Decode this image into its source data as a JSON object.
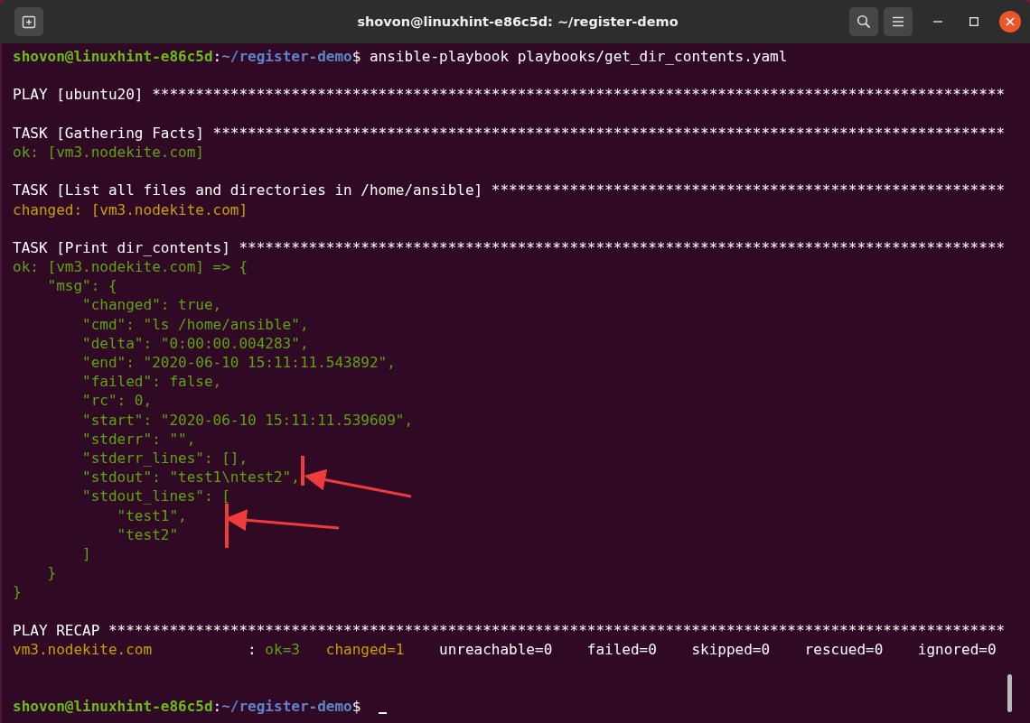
{
  "window": {
    "title": "shovon@linuxhint-e86c5d: ~/register-demo"
  },
  "lines": [
    {
      "spans": [
        {
          "kind": "user",
          "text": "shovon@linuxhint-e86c5d"
        },
        {
          "kind": "plain",
          "text": ":"
        },
        {
          "kind": "path",
          "text": "~/register-demo"
        },
        {
          "kind": "plain",
          "text": "$ ansible-playbook playbooks/get_dir_contents.yaml"
        }
      ]
    },
    {
      "blank_before": true,
      "spans": [
        {
          "kind": "plain",
          "text": "PLAY [ubuntu20] **************************************************************************************************"
        }
      ]
    },
    {
      "blank_before": true,
      "spans": [
        {
          "kind": "plain",
          "text": "TASK [Gathering Facts] *******************************************************************************************"
        }
      ]
    },
    {
      "spans": [
        {
          "kind": "ok",
          "text": "ok: [vm3.nodekite.com]"
        }
      ]
    },
    {
      "blank_before": true,
      "spans": [
        {
          "kind": "plain",
          "text": "TASK [List all files and directories in /home/ansible] ***********************************************************"
        }
      ]
    },
    {
      "spans": [
        {
          "kind": "changed",
          "text": "changed: [vm3.nodekite.com]"
        }
      ]
    },
    {
      "blank_before": true,
      "spans": [
        {
          "kind": "plain",
          "text": "TASK [Print dir_contents] ****************************************************************************************"
        }
      ]
    },
    {
      "spans": [
        {
          "kind": "ok",
          "text": "ok: [vm3.nodekite.com] => {"
        }
      ]
    },
    {
      "spans": [
        {
          "kind": "ok",
          "text": "    \"msg\": {"
        }
      ]
    },
    {
      "spans": [
        {
          "kind": "ok",
          "text": "        \"changed\": true,"
        }
      ]
    },
    {
      "spans": [
        {
          "kind": "ok",
          "text": "        \"cmd\": \"ls /home/ansible\","
        }
      ]
    },
    {
      "spans": [
        {
          "kind": "ok",
          "text": "        \"delta\": \"0:00:00.004283\","
        }
      ]
    },
    {
      "spans": [
        {
          "kind": "ok",
          "text": "        \"end\": \"2020-06-10 15:11:11.543892\","
        }
      ]
    },
    {
      "spans": [
        {
          "kind": "ok",
          "text": "        \"failed\": false,"
        }
      ]
    },
    {
      "spans": [
        {
          "kind": "ok",
          "text": "        \"rc\": 0,"
        }
      ]
    },
    {
      "spans": [
        {
          "kind": "ok",
          "text": "        \"start\": \"2020-06-10 15:11:11.539609\","
        }
      ]
    },
    {
      "spans": [
        {
          "kind": "ok",
          "text": "        \"stderr\": \"\","
        }
      ]
    },
    {
      "spans": [
        {
          "kind": "ok",
          "text": "        \"stderr_lines\": [],"
        }
      ]
    },
    {
      "spans": [
        {
          "kind": "ok",
          "text": "        \"stdout\": \"test1\\ntest2\","
        }
      ]
    },
    {
      "spans": [
        {
          "kind": "ok",
          "text": "        \"stdout_lines\": ["
        }
      ]
    },
    {
      "spans": [
        {
          "kind": "ok",
          "text": "            \"test1\","
        }
      ]
    },
    {
      "spans": [
        {
          "kind": "ok",
          "text": "            \"test2\""
        }
      ]
    },
    {
      "spans": [
        {
          "kind": "ok",
          "text": "        ]"
        }
      ]
    },
    {
      "spans": [
        {
          "kind": "ok",
          "text": "    }"
        }
      ]
    },
    {
      "spans": [
        {
          "kind": "ok",
          "text": "}"
        }
      ]
    },
    {
      "blank_before": true,
      "spans": [
        {
          "kind": "plain",
          "text": "PLAY RECAP *******************************************************************************************************"
        }
      ]
    },
    {
      "blank_after": true,
      "spans": [
        {
          "kind": "changed",
          "text": "vm3.nodekite.com"
        },
        {
          "kind": "plain",
          "text": "           : "
        },
        {
          "kind": "ok",
          "text": "ok=3   "
        },
        {
          "kind": "changed",
          "text": "changed=1"
        },
        {
          "kind": "plain",
          "text": "    unreachable=0    failed=0    skipped=0    rescued=0    ignored=0"
        }
      ]
    },
    {
      "blank_before": true,
      "spans": [
        {
          "kind": "user",
          "text": "shovon@linuxhint-e86c5d"
        },
        {
          "kind": "plain",
          "text": ":"
        },
        {
          "kind": "path",
          "text": "~/register-demo"
        },
        {
          "kind": "plain",
          "text": "$ "
        }
      ],
      "cursor": true
    }
  ]
}
